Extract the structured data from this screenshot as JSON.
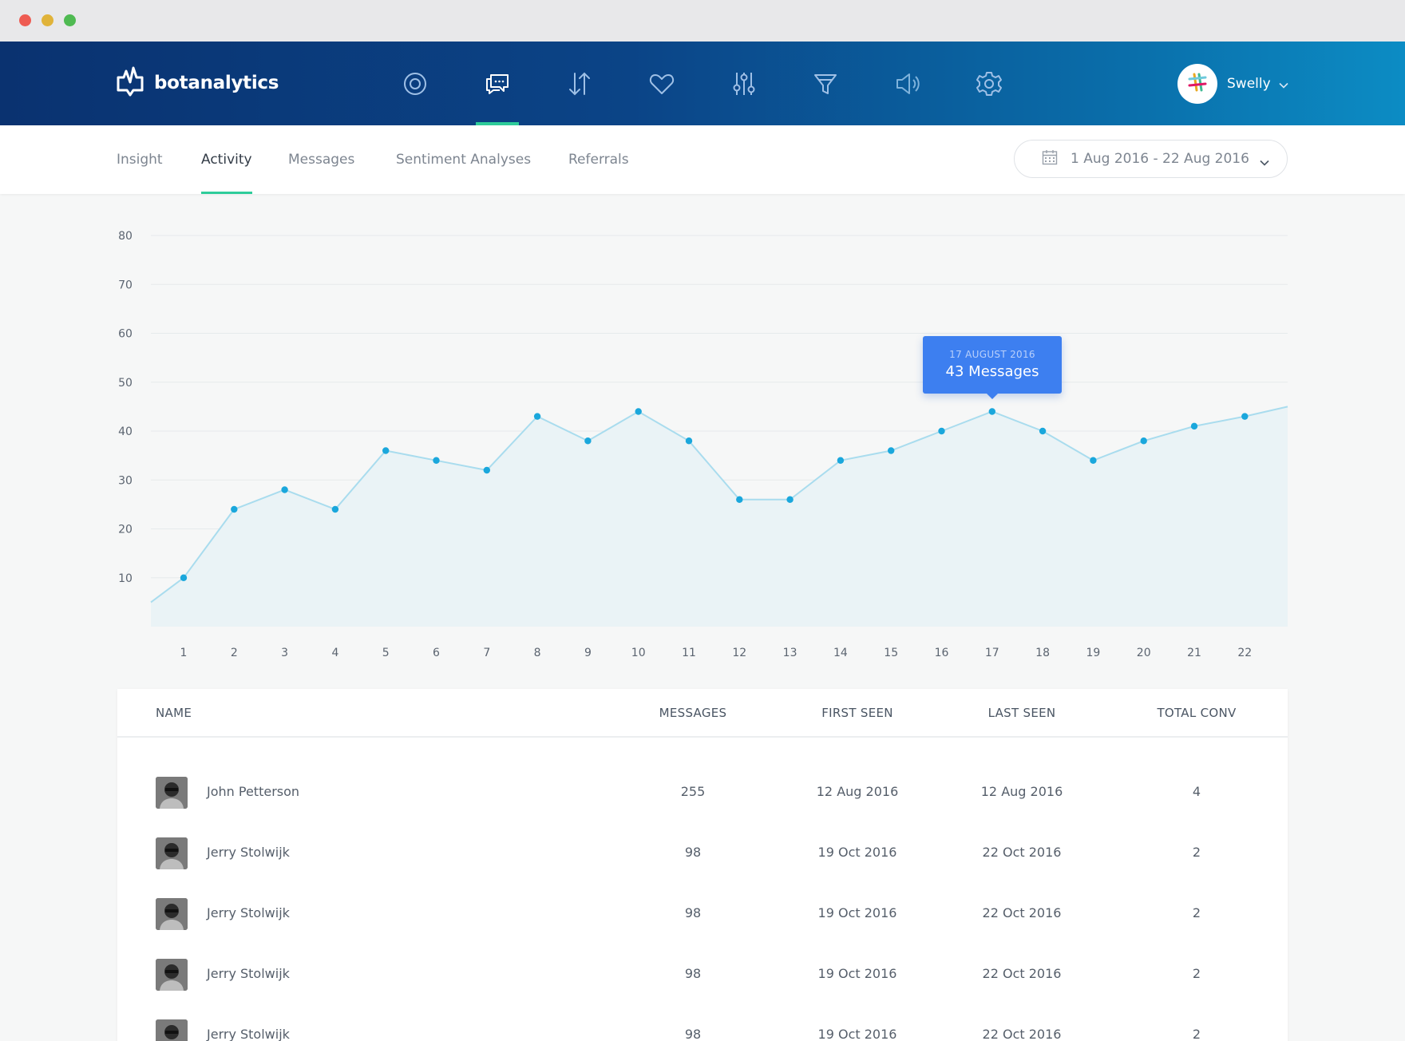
{
  "window": {
    "colors": {
      "close": "#ee5b52",
      "minimize": "#e0b33a",
      "maximize": "#4fba52"
    }
  },
  "header": {
    "brand": "botanalytics",
    "nav_icons": [
      "overview-icon",
      "messages-icon",
      "transfer-icon",
      "heart-icon",
      "sliders-icon",
      "funnel-icon",
      "speaker-icon",
      "gear-icon"
    ],
    "active_nav": "messages-icon",
    "user": {
      "name": "Swelly",
      "avatar_icon": "slack-logo-icon"
    }
  },
  "subnav": {
    "tabs": [
      {
        "label": "Insight",
        "active": false
      },
      {
        "label": "Activity",
        "active": true
      },
      {
        "label": "Messages",
        "active": false
      },
      {
        "label": "Sentiment Analyses",
        "active": false
      },
      {
        "label": "Referrals",
        "active": false
      }
    ],
    "date_range": "1 Aug 2016 -  22 Aug 2016"
  },
  "chart_data": {
    "type": "area",
    "x": [
      1,
      2,
      3,
      4,
      5,
      6,
      7,
      8,
      9,
      10,
      11,
      12,
      13,
      14,
      15,
      16,
      17,
      18,
      19,
      20,
      21,
      22
    ],
    "series": [
      {
        "values": [
          10,
          24,
          28,
          24,
          36,
          34,
          32,
          43,
          38,
          44,
          38,
          26,
          26,
          34,
          36,
          40,
          44,
          40,
          34,
          38,
          41,
          43
        ]
      }
    ],
    "ylim": [
      0,
      80
    ],
    "yticks": [
      10,
      20,
      30,
      40,
      50,
      60,
      70,
      80
    ],
    "grid": true,
    "tooltip": {
      "date": "17 AUGUST 2016",
      "value": "43 Messages",
      "x": 17
    },
    "colors": {
      "line": "#a9dcee",
      "point": "#1aa7dc",
      "fill": "#eaf3f6"
    }
  },
  "table": {
    "columns": [
      "NAME",
      "MESSAGES",
      "FIRST SEEN",
      "LAST SEEN",
      "TOTAL CONV"
    ],
    "rows": [
      {
        "name": "John Petterson",
        "messages": "255",
        "first_seen": "12 Aug 2016",
        "last_seen": "12 Aug 2016",
        "total_conv": "4"
      },
      {
        "name": "Jerry Stolwijk",
        "messages": "98",
        "first_seen": "19 Oct 2016",
        "last_seen": "22 Oct 2016",
        "total_conv": "2"
      },
      {
        "name": "Jerry Stolwijk",
        "messages": "98",
        "first_seen": "19 Oct 2016",
        "last_seen": "22 Oct 2016",
        "total_conv": "2"
      },
      {
        "name": "Jerry Stolwijk",
        "messages": "98",
        "first_seen": "19 Oct 2016",
        "last_seen": "22 Oct 2016",
        "total_conv": "2"
      },
      {
        "name": "Jerry Stolwijk",
        "messages": "98",
        "first_seen": "19 Oct 2016",
        "last_seen": "22 Oct 2016",
        "total_conv": "2"
      }
    ]
  }
}
